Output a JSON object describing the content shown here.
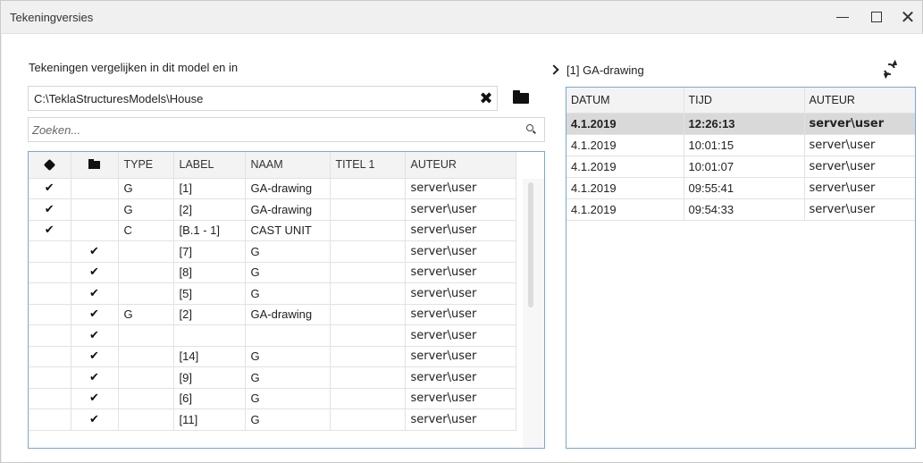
{
  "window": {
    "title": "Tekeningversies",
    "min_icon": "minimize-icon",
    "max_icon": "maximize-icon",
    "close_icon": "close-icon"
  },
  "left": {
    "compare_label": "Tekeningen vergelijken in dit model en in",
    "path_value": "C:\\TeklaStructuresModels\\House",
    "search_placeholder": "Zoeken...",
    "columns": [
      "",
      "",
      "TYPE",
      "LABEL",
      "NAAM",
      "TITEL 1",
      "AUTEUR"
    ],
    "header_icons": [
      "model-cube-icon",
      "folder-icon"
    ],
    "rows": [
      {
        "model": "✔",
        "folder": "",
        "type": "G",
        "label": "[1]",
        "naam": "GA-drawing",
        "titel": "",
        "auteur": "server\\user"
      },
      {
        "model": "✔",
        "folder": "",
        "type": "G",
        "label": "[2]",
        "naam": "GA-drawing",
        "titel": "",
        "auteur": "server\\user"
      },
      {
        "model": "✔",
        "folder": "",
        "type": "C",
        "label": "[B.1 - 1]",
        "naam": "CAST UNIT",
        "titel": "",
        "auteur": "server\\user"
      },
      {
        "model": "",
        "folder": "✔",
        "type": "",
        "label": "[7]",
        "naam": "G",
        "titel": "",
        "auteur": "server\\user"
      },
      {
        "model": "",
        "folder": "✔",
        "type": "",
        "label": "[8]",
        "naam": "G",
        "titel": "",
        "auteur": "server\\user"
      },
      {
        "model": "",
        "folder": "✔",
        "type": "",
        "label": "[5]",
        "naam": "G",
        "titel": "",
        "auteur": "server\\user"
      },
      {
        "model": "",
        "folder": "✔",
        "type": "G",
        "label": "[2]",
        "naam": "GA-drawing",
        "titel": "",
        "auteur": "server\\user"
      },
      {
        "model": "",
        "folder": "✔",
        "type": "",
        "label": "",
        "naam": "",
        "titel": "",
        "auteur": "server\\user"
      },
      {
        "model": "",
        "folder": "✔",
        "type": "",
        "label": "[14]",
        "naam": "G",
        "titel": "",
        "auteur": "server\\user"
      },
      {
        "model": "",
        "folder": "✔",
        "type": "",
        "label": "[9]",
        "naam": "G",
        "titel": "",
        "auteur": "server\\user"
      },
      {
        "model": "",
        "folder": "✔",
        "type": "",
        "label": "[6]",
        "naam": "G",
        "titel": "",
        "auteur": "server\\user"
      },
      {
        "model": "",
        "folder": "✔",
        "type": "",
        "label": "[11]",
        "naam": "G",
        "titel": "",
        "auteur": "server\\user"
      }
    ]
  },
  "right": {
    "selected_drawing": "[1] GA-drawing",
    "refresh_icon": "refresh-icon",
    "columns": [
      "DATUM",
      "TIJD",
      "AUTEUR"
    ],
    "rows": [
      {
        "datum": "4.1.2019",
        "tijd": "12:26:13",
        "auteur": "server\\user",
        "selected": true
      },
      {
        "datum": "4.1.2019",
        "tijd": "10:01:15",
        "auteur": "server\\user",
        "selected": false
      },
      {
        "datum": "4.1.2019",
        "tijd": "10:01:07",
        "auteur": "server\\user",
        "selected": false
      },
      {
        "datum": "4.1.2019",
        "tijd": "09:55:41",
        "auteur": "server\\user",
        "selected": false
      },
      {
        "datum": "4.1.2019",
        "tijd": "09:54:33",
        "auteur": "server\\user",
        "selected": false
      }
    ]
  }
}
